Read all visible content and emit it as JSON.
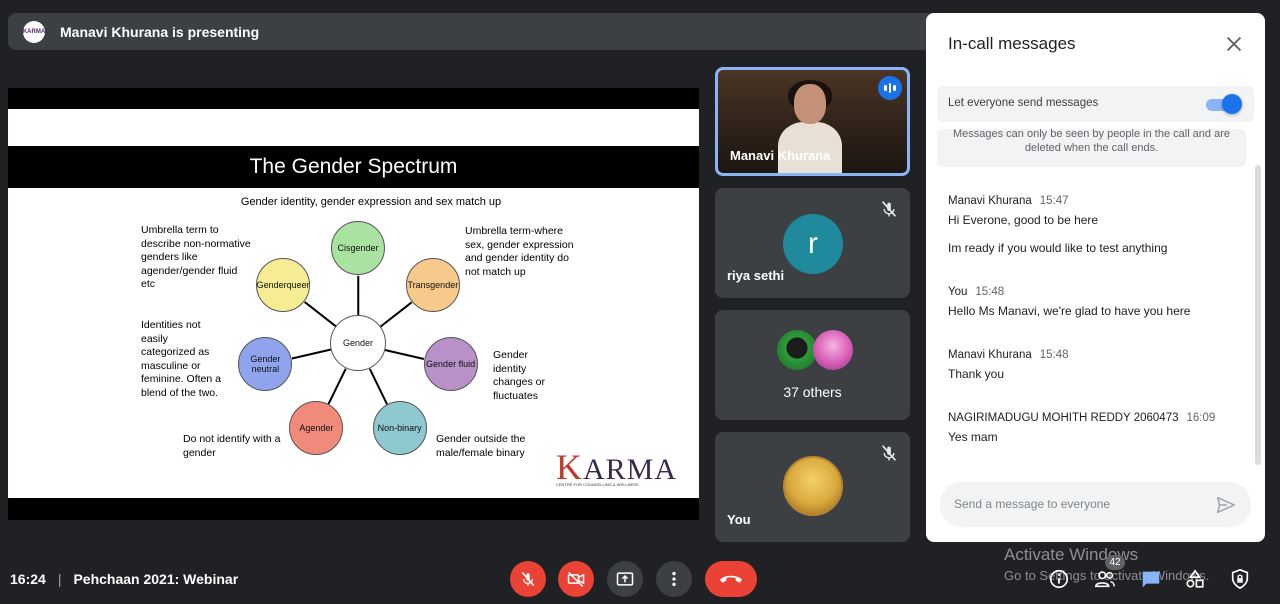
{
  "header": {
    "logo_text": "KARMA",
    "presenting": "Manavi Khurana is presenting"
  },
  "slide": {
    "title": "The Gender Spectrum",
    "subtitle": "Gender identity, gender expression and sex match up",
    "text_umbrella_left": "Umbrella term to describe non-normative genders like agender/gender fluid etc",
    "text_identities": "Identities not easily categorized as masculine or feminine. Often a blend of the two.",
    "text_do_not": "Do not identify with a gender",
    "text_umbrella_right": "Umbrella term-where sex, gender expression and gender identity do not match up",
    "text_fluid_desc": "Gender identity changes or fluctuates",
    "text_outside": "Gender outside the male/female binary",
    "center": "Gender",
    "nodes": [
      "Cisgender",
      "Transgender",
      "Gender fluid",
      "Non-binary",
      "Agender",
      "Gender neutral",
      "Genderqueer"
    ],
    "node_colors": [
      "#a9e3a0",
      "#f7c98b",
      "#b791c8",
      "#8ec9cf",
      "#f08a7a",
      "#8fa4ec",
      "#f6ec94"
    ],
    "logo_first": "K",
    "logo_rest": "ARMA",
    "logo_tagline": "CENTRE FOR COUNSELLING & WELLNESS"
  },
  "participants": {
    "presenter_name": "Manavi Khurana",
    "riya_name": "riya sethi",
    "riya_initial": "r",
    "others_label": "37 others",
    "you_label": "You"
  },
  "chat": {
    "title": "In-call messages",
    "toggle_label": "Let everyone send messages",
    "notice": "Messages can only be seen by people in the call and are deleted when the call ends.",
    "messages": [
      {
        "sender": "Manavi Khurana",
        "time": "15:47",
        "lines": [
          "Hi Everone, good to be here",
          "Im ready if you would like to test anything"
        ]
      },
      {
        "sender": "You",
        "time": "15:48",
        "lines": [
          "Hello Ms Manavi, we're glad to have you here"
        ]
      },
      {
        "sender": "Manavi Khurana",
        "time": "15:48",
        "lines": [
          "Thank you"
        ]
      },
      {
        "sender": "NAGIRIMADUGU MOHITH REDDY 2060473",
        "time": "16:09",
        "lines": [
          "Yes mam"
        ]
      }
    ],
    "input_placeholder": "Send a message to everyone"
  },
  "footer": {
    "time": "16:24",
    "meeting_name": "Pehchaan 2021: Webinar",
    "participant_count": "42"
  },
  "watermark": {
    "line1": "Activate Windows",
    "line2": "Go to Settings to activate Windows."
  }
}
